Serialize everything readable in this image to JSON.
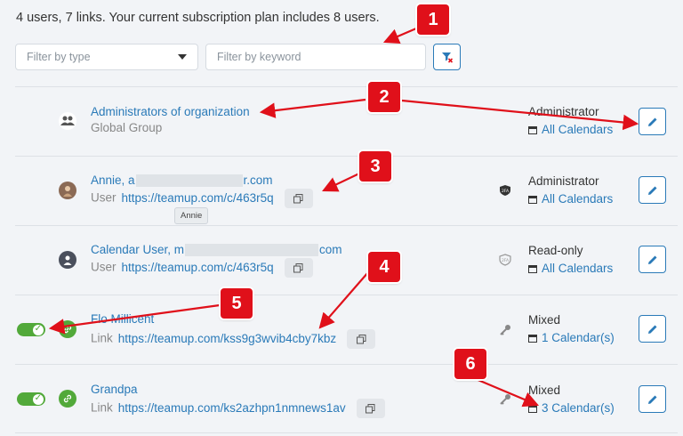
{
  "summary": "4 users, 7 links. Your current subscription plan includes 8 users.",
  "filters": {
    "type_placeholder": "Filter by type",
    "keyword_placeholder": "Filter by keyword"
  },
  "tooltip": "Annie",
  "rows": [
    {
      "name": "Administrators of organization",
      "kind": "Global Group",
      "role": "Administrator",
      "calendars": "All Calendars"
    },
    {
      "name_start": "Annie, a",
      "name_end": "r.com",
      "kind": "User",
      "link": "https://teamup.com/c/463r5q",
      "role": "Administrator",
      "calendars": "All Calendars"
    },
    {
      "name_start": "Calendar User, m",
      "name_end": "com",
      "kind": "User",
      "link": "https://teamup.com/c/463r5q",
      "role": "Read-only",
      "calendars": "All Calendars"
    },
    {
      "name": "Flo Millicent",
      "kind": "Link",
      "link": "https://teamup.com/kss9g3wvib4cby7kbz",
      "role": "Mixed",
      "calendars": "1 Calendar(s)"
    },
    {
      "name": "Grandpa",
      "kind": "Link",
      "link": "https://teamup.com/ks2azhpn1nmnews1av",
      "role": "Mixed",
      "calendars": "3 Calendar(s)"
    }
  ],
  "annotations": [
    "1",
    "2",
    "3",
    "4",
    "5",
    "6"
  ],
  "colors": {
    "accent": "#2a7ab8",
    "toggle_on": "#52a93a",
    "annotation": "#e0101a"
  }
}
